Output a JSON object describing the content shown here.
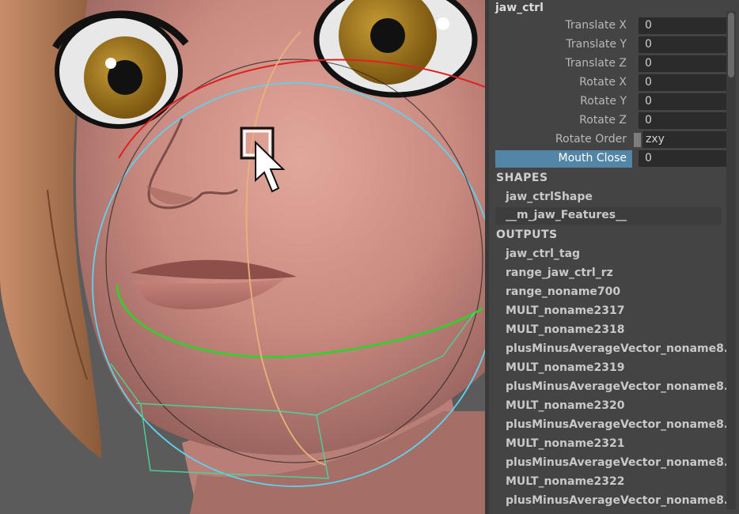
{
  "viewport": {
    "cursor_icon": "arrow-cursor-icon",
    "manipulator_icon": "square-manipulator-icon"
  },
  "attribute_editor": {
    "node_name": "jaw_ctrl",
    "attributes": [
      {
        "label": "Translate X",
        "value": "0"
      },
      {
        "label": "Translate Y",
        "value": "0"
      },
      {
        "label": "Translate Z",
        "value": "0"
      },
      {
        "label": "Rotate X",
        "value": "0"
      },
      {
        "label": "Rotate Y",
        "value": "0"
      },
      {
        "label": "Rotate Z",
        "value": "0"
      }
    ],
    "rotate_order": {
      "label": "Rotate Order",
      "value": "zxy"
    },
    "mouth_close": {
      "label": "Mouth Close",
      "value": "0"
    },
    "shapes_header": "SHAPES",
    "shapes": [
      "jaw_ctrlShape",
      "__m_jaw_Features__"
    ],
    "outputs_header": "OUTPUTS",
    "outputs": [
      "jaw_ctrl_tag",
      "range_jaw_ctrl_rz",
      "range_noname700",
      "MULT_noname2317",
      "MULT_noname2318",
      "plusMinusAverageVector_noname8...",
      "MULT_noname2319",
      "plusMinusAverageVector_noname8...",
      "MULT_noname2320",
      "plusMinusAverageVector_noname8...",
      "MULT_noname2321",
      "plusMinusAverageVector_noname8...",
      "MULT_noname2322",
      "plusMinusAverageVector_noname8..."
    ],
    "selected_color": "#5285a6"
  }
}
